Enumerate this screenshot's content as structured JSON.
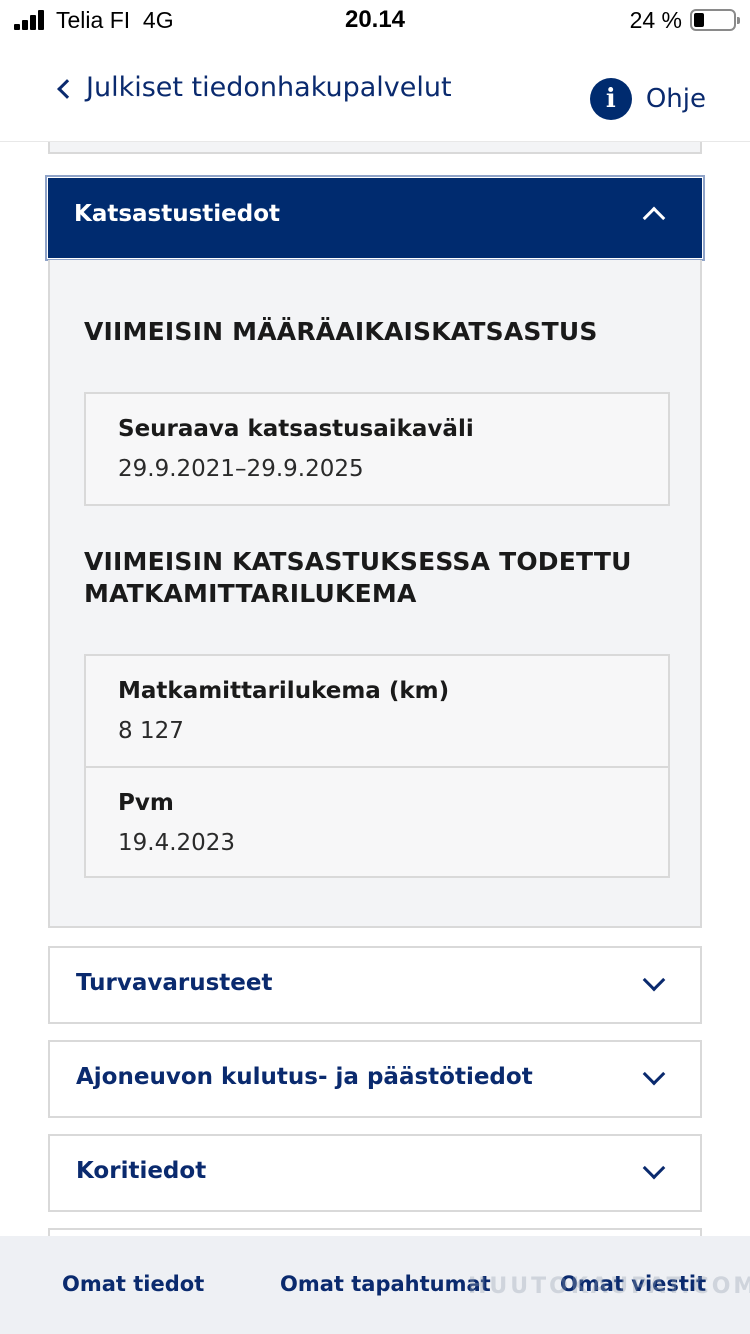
{
  "status_bar": {
    "carrier": "Telia FI",
    "network": "4G",
    "time": "20.14",
    "battery": "24 %"
  },
  "header": {
    "back_label": "Julkiset tiedonhakupalvelut",
    "help_icon_glyph": "i",
    "help_label": "Ohje"
  },
  "open_section": {
    "title": "Katsastustiedot",
    "heading1": "VIIMEISIN MÄÄRÄAIKAISKATSASTUS",
    "box1": {
      "label": "Seuraava katsastusaikaväli",
      "value": "29.9.2021–29.9.2025"
    },
    "heading2_line1": "VIIMEISIN KATSASTUKSESSA TODETTU",
    "heading2_line2": "MATKAMITTARILUKEMA",
    "box2": [
      {
        "label": "Matkamittarilukema (km)",
        "value": "8 127"
      },
      {
        "label": "Pvm",
        "value": "19.4.2023"
      }
    ]
  },
  "closed_sections": [
    {
      "title": "Turvavarusteet"
    },
    {
      "title": "Ajoneuvon kulutus- ja päästötiedot"
    },
    {
      "title": "Koritiedot"
    }
  ],
  "bottom_nav": {
    "items": [
      {
        "label": "Omat tiedot"
      },
      {
        "label": "Omat tapahtumat"
      },
      {
        "label": "Omat viestit"
      }
    ]
  },
  "watermark": "HUUTOKAUPAT.COM",
  "colors": {
    "primary": "#002b6f",
    "link": "#0a2a6e",
    "panel_bg": "#f3f4f6",
    "border": "#d9d9d9"
  }
}
